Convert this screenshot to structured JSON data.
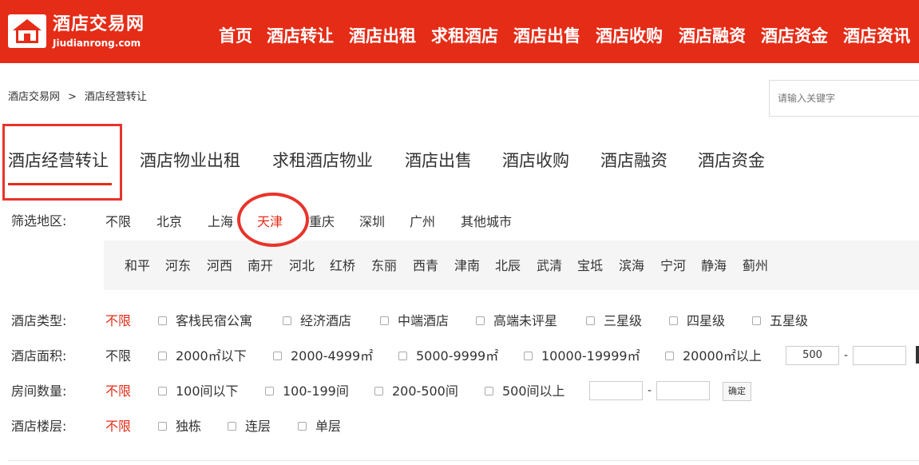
{
  "header": {
    "brand_title": "酒店交易网",
    "brand_subtitle": "Jiudianrong.com",
    "nav": [
      "首页",
      "酒店转让",
      "酒店出租",
      "求租酒店",
      "酒店出售",
      "酒店收购",
      "酒店融资",
      "酒店资金",
      "酒店资讯"
    ]
  },
  "breadcrumb": {
    "home": "酒店交易网",
    "separator": ">",
    "current": "酒店经营转让"
  },
  "search": {
    "placeholder": "请输入关键字"
  },
  "tabs": [
    "酒店经营转让",
    "酒店物业出租",
    "求租酒店物业",
    "酒店出售",
    "酒店收购",
    "酒店融资",
    "酒店资金"
  ],
  "region": {
    "label": "筛选地区:",
    "options": [
      "不限",
      "北京",
      "上海",
      "天津",
      "重庆",
      "深圳",
      "广州",
      "其他城市"
    ],
    "selected": "天津",
    "districts": [
      "和平",
      "河东",
      "河西",
      "南开",
      "河北",
      "红桥",
      "东丽",
      "西青",
      "津南",
      "北辰",
      "武清",
      "宝坻",
      "滨海",
      "宁河",
      "静海",
      "蓟州"
    ]
  },
  "hotel_type": {
    "label": "酒店类型:",
    "any": "不限",
    "options": [
      "客栈民宿公寓",
      "经济酒店",
      "中端酒店",
      "高端未评星",
      "三星级",
      "四星级",
      "五星级"
    ]
  },
  "hotel_area": {
    "label": "酒店面积:",
    "any": "不限",
    "options": [
      "2000㎡以下",
      "2000-4999㎡",
      "5000-9999㎡",
      "10000-19999㎡",
      "20000㎡以上"
    ],
    "min_value": "500",
    "dash": "-"
  },
  "room_count": {
    "label": "房间数量:",
    "any": "不限",
    "options": [
      "100间以下",
      "100-199间",
      "200-500间",
      "500间以上"
    ],
    "dash": "-",
    "confirm": "确定"
  },
  "floors": {
    "label": "酒店楼层:",
    "any": "不限",
    "options": [
      "独栋",
      "连层",
      "单层"
    ]
  },
  "colors": {
    "accent": "#e52c17"
  }
}
